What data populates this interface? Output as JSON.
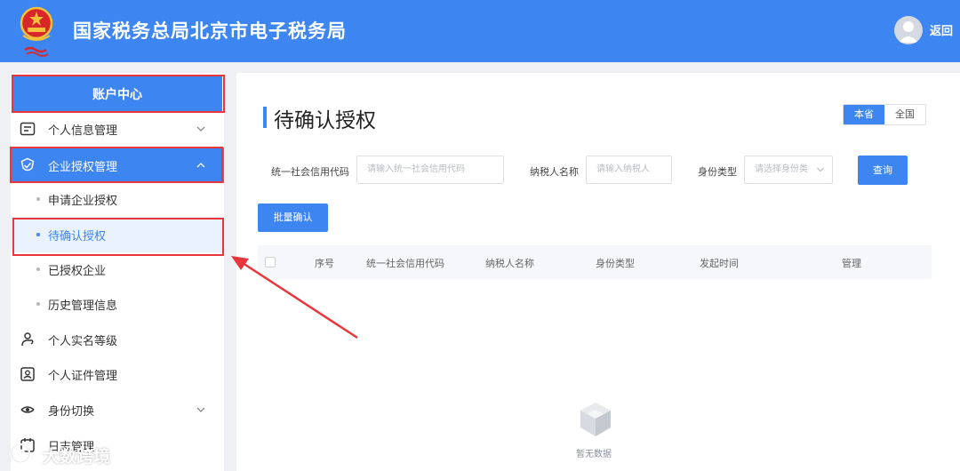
{
  "header": {
    "site_title": "国家税务总局北京市电子税务局",
    "back_label": "返回"
  },
  "sidebar": {
    "account_center": "账户中心",
    "items": [
      {
        "label": "个人信息管理",
        "icon": "id-card-icon",
        "expandable": true
      },
      {
        "label": "企业授权管理",
        "icon": "shield-check-icon",
        "expandable": true,
        "expanded": true,
        "active": true
      },
      {
        "label": "申请企业授权",
        "sub": true
      },
      {
        "label": "待确认授权",
        "sub": true,
        "active": true
      },
      {
        "label": "已授权企业",
        "sub": true
      },
      {
        "label": "历史管理信息",
        "sub": true
      },
      {
        "label": "个人实名等级",
        "icon": "user-hand-icon"
      },
      {
        "label": "个人证件管理",
        "icon": "id-badge-icon"
      },
      {
        "label": "身份切换",
        "icon": "switch-icon",
        "expandable": true
      },
      {
        "label": "日志管理",
        "icon": "log-icon"
      }
    ]
  },
  "main": {
    "page_title": "待确认授权",
    "scope_tabs": [
      {
        "label": "本省",
        "selected": true
      },
      {
        "label": "全国",
        "selected": false
      }
    ],
    "filters": {
      "credit_code_label": "统一社会信用代码",
      "credit_code_placeholder": "请输入统一社会信用代码",
      "taxpayer_label": "纳税人名称",
      "taxpayer_placeholder": "请输入纳税人",
      "identity_label": "身份类型",
      "identity_placeholder": "请选择身份类"
    },
    "query_button": "查询",
    "batch_confirm_button": "批量确认",
    "table": {
      "columns": [
        "序号",
        "统一社会信用代码",
        "纳税人名称",
        "身份类型",
        "发起时间",
        "管理"
      ]
    },
    "empty_text": "暂无数据"
  },
  "watermark": "大数跨境",
  "colors": {
    "primary": "#3d85f0",
    "highlight_red": "#e8363c",
    "sub_active_bg": "#eaf2fe"
  }
}
